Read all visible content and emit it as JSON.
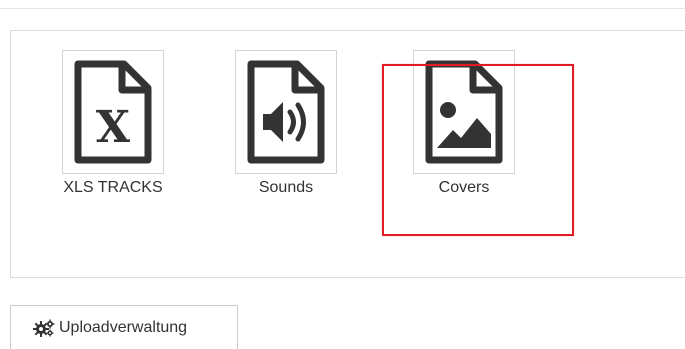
{
  "tiles": [
    {
      "label": "XLS TRACKS",
      "icon": "xls-file-icon"
    },
    {
      "label": "Sounds",
      "icon": "sound-file-icon"
    },
    {
      "label": "Covers",
      "icon": "image-file-icon",
      "selected": true
    }
  ],
  "upload_button": {
    "label": "Uploadverwaltung",
    "icon": "cogs-icon"
  },
  "colors": {
    "selection_border": "#e01b24",
    "icon_stroke": "#333333",
    "tile_border": "#d4d4d4"
  }
}
